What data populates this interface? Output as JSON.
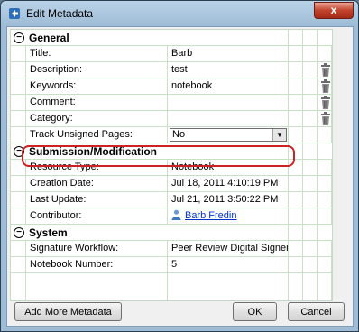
{
  "window": {
    "title": "Edit Metadata",
    "close_glyph": "x"
  },
  "sections": {
    "general": {
      "title": "General",
      "toggle": "⊖"
    },
    "submission": {
      "title": "Submission/Modification",
      "toggle": "⊖"
    },
    "system": {
      "title": "System",
      "toggle": "⊖"
    }
  },
  "general_rows": [
    {
      "label": "Title:",
      "value": "Barb"
    },
    {
      "label": "Description:",
      "value": "test"
    },
    {
      "label": "Keywords:",
      "value": "notebook"
    },
    {
      "label": "Comment:",
      "value": ""
    },
    {
      "label": "Category:",
      "value": ""
    },
    {
      "label": "Track Unsigned Pages:",
      "value": "No"
    }
  ],
  "submission_rows": [
    {
      "label": "Resource Type:",
      "value": "Notebook"
    },
    {
      "label": "Creation Date:",
      "value": "Jul 18, 2011 4:10:19 PM"
    },
    {
      "label": "Last Update:",
      "value": "Jul 21, 2011 3:50:22 PM"
    },
    {
      "label": "Contributor:",
      "value": "Barb Fredin"
    }
  ],
  "system_rows": [
    {
      "label": "Signature Workflow:",
      "value": "Peer Review Digital Signer"
    },
    {
      "label": "Notebook Number:",
      "value": "5"
    }
  ],
  "buttons": {
    "add_more": "Add More Metadata",
    "ok": "OK",
    "cancel": "Cancel"
  },
  "icons": {
    "trash": "trash-icon",
    "user": "user-icon",
    "window": "metadata-window-icon"
  },
  "colors": {
    "highlight": "#cc2222",
    "link": "#0033cc",
    "grid_line": "#c8e0c8"
  }
}
